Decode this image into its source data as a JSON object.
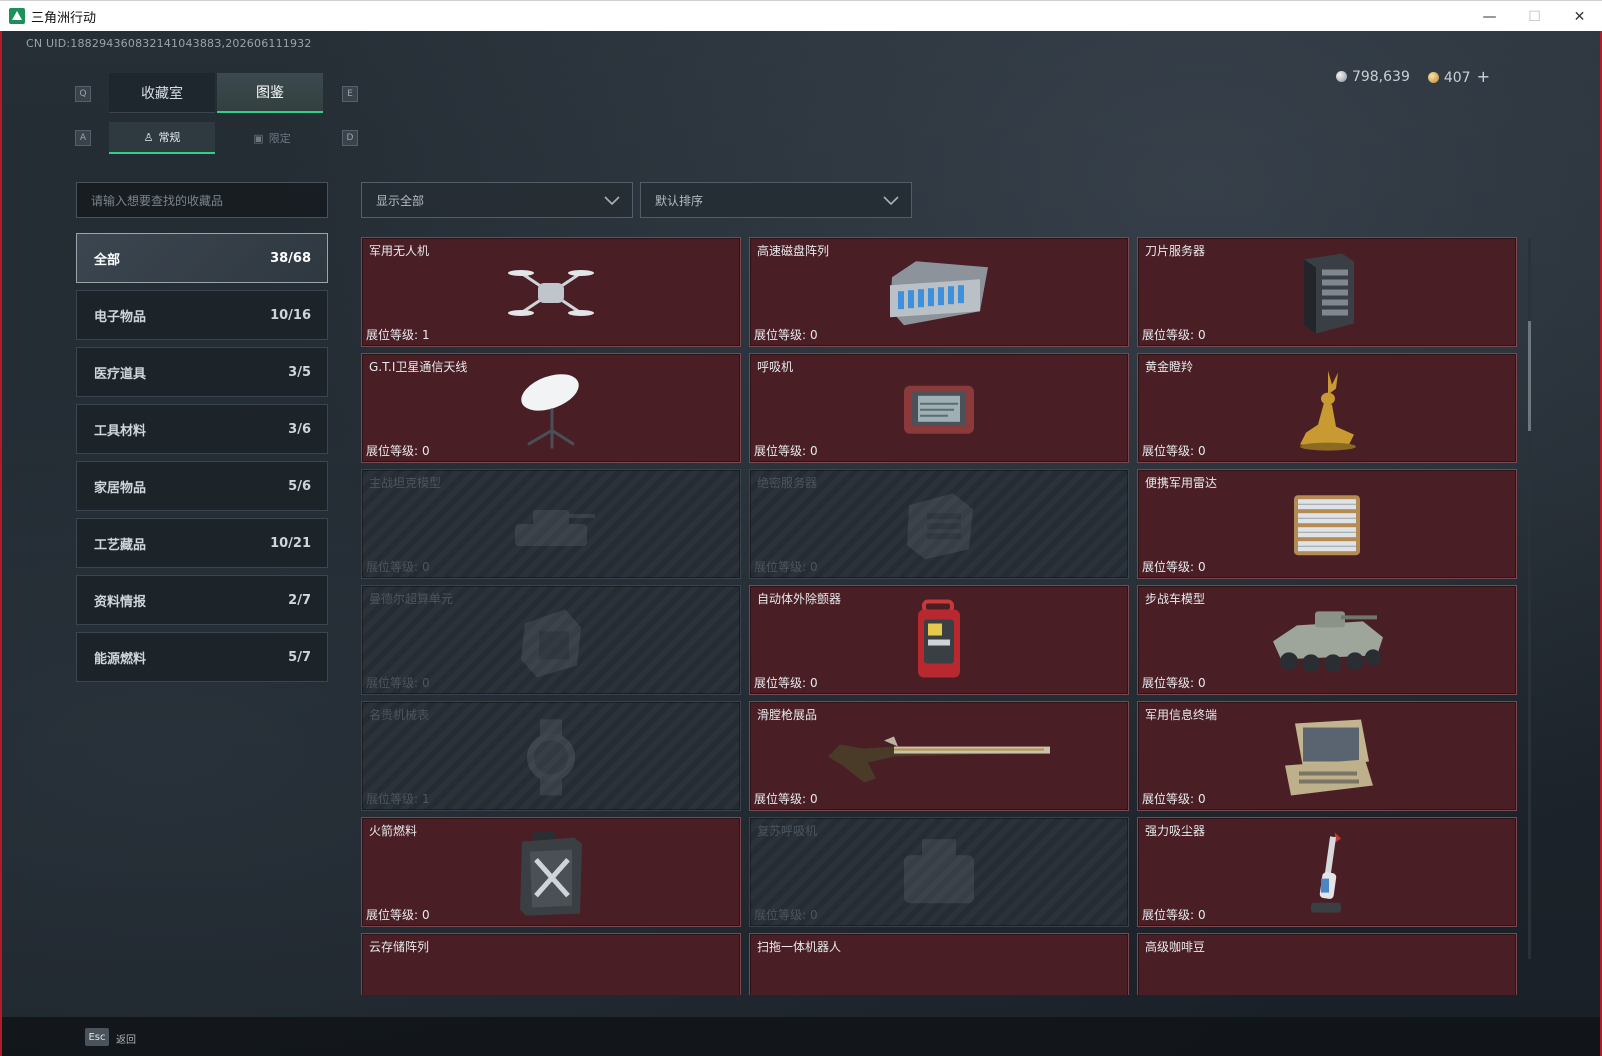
{
  "window": {
    "title": "三角洲行动",
    "minimize_glyph": "—",
    "maximize_glyph": "☐",
    "close_glyph": "✕"
  },
  "uid_text": "CN UID:18829436083214104388З,202606111932",
  "currency": {
    "silver": "798,639",
    "gold": "407",
    "add_glyph": "+"
  },
  "key_hints": {
    "prev_tab": "Q",
    "next_tab": "E",
    "prev_sub": "A",
    "next_sub": "D"
  },
  "tabs": {
    "main": [
      "收藏室",
      "图鉴"
    ],
    "main_active": 1,
    "sub": [
      "常规",
      "限定"
    ],
    "sub_active": 0
  },
  "search": {
    "placeholder": "请输入想要查找的收藏品"
  },
  "filter": {
    "value": "显示全部"
  },
  "sort": {
    "value": "默认排序"
  },
  "categories": [
    {
      "label": "全部",
      "count": "38/68"
    },
    {
      "label": "电子物品",
      "count": "10/16"
    },
    {
      "label": "医疗道具",
      "count": "3/5"
    },
    {
      "label": "工具材料",
      "count": "3/6"
    },
    {
      "label": "家居物品",
      "count": "5/6"
    },
    {
      "label": "工艺藏品",
      "count": "10/21"
    },
    {
      "label": "资料情报",
      "count": "2/7"
    },
    {
      "label": "能源燃料",
      "count": "5/7"
    }
  ],
  "level_label": "展位等级:",
  "items": [
    {
      "name": "军用无人机",
      "level": "1",
      "unlocked": true,
      "icon": "drone-icon"
    },
    {
      "name": "高速磁盘阵列",
      "level": "0",
      "unlocked": true,
      "icon": "disk-array-icon"
    },
    {
      "name": "刀片服务器",
      "level": "0",
      "unlocked": true,
      "icon": "blade-server-icon"
    },
    {
      "name": "G.T.I卫星通信天线",
      "level": "0",
      "unlocked": true,
      "icon": "satellite-dish-icon"
    },
    {
      "name": "呼吸机",
      "level": "0",
      "unlocked": true,
      "icon": "ventilator-icon"
    },
    {
      "name": "黄金瞪羚",
      "level": "0",
      "unlocked": true,
      "icon": "golden-gazelle-icon"
    },
    {
      "name": "主战坦克模型",
      "level": "0",
      "unlocked": false,
      "icon": "tank-model-icon"
    },
    {
      "name": "绝密服务器",
      "level": "0",
      "unlocked": false,
      "icon": "server-icon"
    },
    {
      "name": "便携军用雷达",
      "level": "0",
      "unlocked": true,
      "icon": "radar-icon"
    },
    {
      "name": "曼德尔超算单元",
      "level": "0",
      "unlocked": false,
      "icon": "supercomputer-icon"
    },
    {
      "name": "自动体外除颤器",
      "level": "0",
      "unlocked": true,
      "icon": "defibrillator-icon"
    },
    {
      "name": "步战车模型",
      "level": "0",
      "unlocked": true,
      "icon": "ifv-model-icon"
    },
    {
      "name": "名贵机械表",
      "level": "1",
      "unlocked": false,
      "icon": "watch-icon"
    },
    {
      "name": "滑膛枪展品",
      "level": "0",
      "unlocked": true,
      "icon": "musket-icon"
    },
    {
      "name": "军用信息终端",
      "level": "0",
      "unlocked": true,
      "icon": "terminal-icon"
    },
    {
      "name": "火箭燃料",
      "level": "0",
      "unlocked": true,
      "icon": "fuel-can-icon"
    },
    {
      "name": "复苏呼吸机",
      "level": "0",
      "unlocked": false,
      "icon": "resuscitator-icon"
    },
    {
      "name": "强力吸尘器",
      "level": "0",
      "unlocked": true,
      "icon": "vacuum-icon"
    },
    {
      "name": "云存储阵列",
      "level": "",
      "unlocked": true,
      "icon": "cloud-storage-icon"
    },
    {
      "name": "扫拖一体机器人",
      "level": "",
      "unlocked": true,
      "icon": "robot-vacuum-icon"
    },
    {
      "name": "高级咖啡豆",
      "level": "",
      "unlocked": true,
      "icon": "coffee-beans-icon"
    }
  ],
  "bottom": {
    "esc_key": "Esc",
    "esc_label": "返回"
  }
}
